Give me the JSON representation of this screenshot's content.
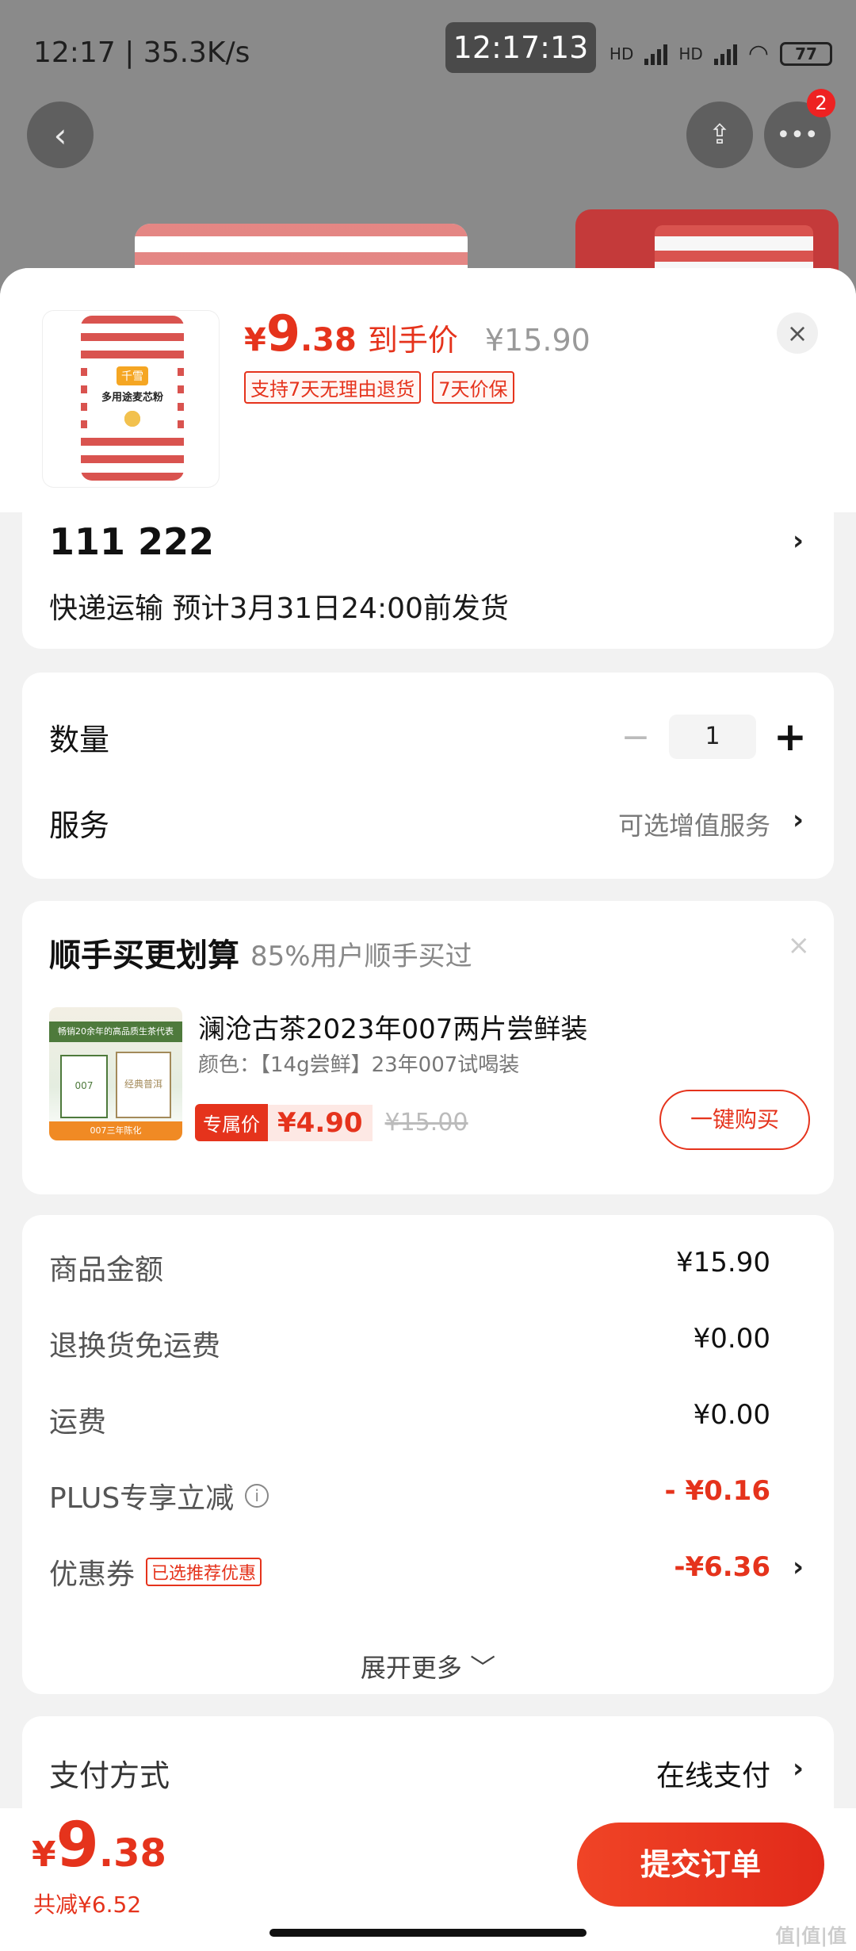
{
  "status_bar": {
    "time_speed": "12:17 | 35.3K/s",
    "clock": "12:17:13",
    "hd1": "HD",
    "hd2": "HD",
    "battery": "77"
  },
  "background": {
    "back_icon": "chevron-left-icon",
    "share_icon": "share-icon",
    "more_icon": "more-icon",
    "more_badge": "2"
  },
  "product": {
    "brand": "千雪",
    "bag_name": "多用途麦芯粉",
    "price_yen": "¥",
    "price_int": "9",
    "price_dec": ".38",
    "price_label": "到手价",
    "orig_price": "¥15.90",
    "tags": [
      "支持7天无理由退货",
      "7天价保"
    ],
    "close": "×"
  },
  "address": {
    "name": "111  222",
    "shipping": "快递运输 预计3月31日24:00前发货",
    "chevron": "›"
  },
  "quantity": {
    "label": "数量",
    "minus": "−",
    "value": "1",
    "plus": "+"
  },
  "service": {
    "label": "服务",
    "value": "可选增值服务",
    "chevron": "›"
  },
  "upsell": {
    "title": "顺手买更划算",
    "subtitle": "85%用户顺手买过",
    "close": "×",
    "img_strip": "畅销20余年的高品质生茶代表",
    "img_box1": "007",
    "img_box2": "经典普洱",
    "img_bottom": "007三年陈化",
    "name": "澜沧古茶2023年007两片尝鲜装",
    "spec": "颜色：【14g尝鲜】23年007试喝装",
    "flag": "专属价",
    "price": "¥4.90",
    "was": "¥15.00",
    "buy": "一键购买"
  },
  "summary": {
    "rows": [
      {
        "key": "商品金额",
        "value": "¥15.90"
      },
      {
        "key": "退换货免运费",
        "value": "¥0.00"
      },
      {
        "key": "运费",
        "value": "¥0.00"
      },
      {
        "key": "PLUS专享立减",
        "value": "- ¥0.16"
      },
      {
        "key": "优惠券",
        "value": "-¥6.36",
        "tag": "已选推荐优惠"
      }
    ],
    "more": "展开更多 ﹀"
  },
  "payment": {
    "label": "支付方式",
    "value": "在线支付",
    "chevron": "›"
  },
  "bottom": {
    "yen": "¥",
    "int": "9",
    "dec": ".38",
    "saved": "共减¥6.52",
    "submit": "提交订单",
    "watermark": "值|值|值"
  },
  "colors": {
    "accent": "#e5331c",
    "background": "#f2f2f2"
  }
}
